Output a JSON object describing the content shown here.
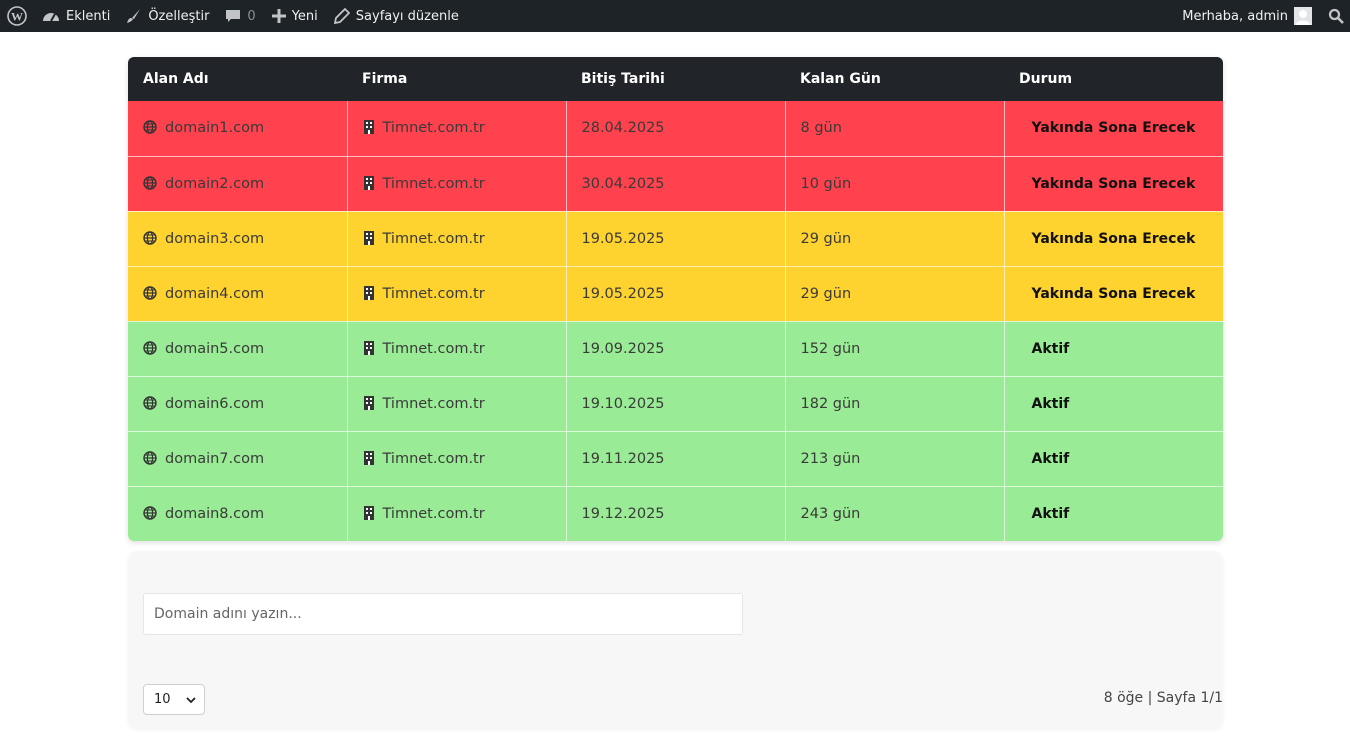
{
  "adminbar": {
    "plugins_label": "Eklenti",
    "customize_label": "Özelleştir",
    "comments_count": "0",
    "new_label": "Yeni",
    "edit_page_label": "Sayfayı düzenle",
    "greeting": "Merhaba, admin"
  },
  "table": {
    "headers": [
      "Alan Adı",
      "Firma",
      "Bitiş Tarihi",
      "Kalan Gün",
      "Durum"
    ],
    "rows": [
      {
        "domain": "domain1.com",
        "company": "Timnet.com.tr",
        "end_date": "28.04.2025",
        "days_left": "8 gün",
        "status": "Yakında Sona Erecek",
        "color": "#ff424e"
      },
      {
        "domain": "domain2.com",
        "company": "Timnet.com.tr",
        "end_date": "30.04.2025",
        "days_left": "10 gün",
        "status": "Yakında Sona Erecek",
        "color": "#ff424e"
      },
      {
        "domain": "domain3.com",
        "company": "Timnet.com.tr",
        "end_date": "19.05.2025",
        "days_left": "29 gün",
        "status": "Yakında Sona Erecek",
        "color": "#fed22f"
      },
      {
        "domain": "domain4.com",
        "company": "Timnet.com.tr",
        "end_date": "19.05.2025",
        "days_left": "29 gün",
        "status": "Yakında Sona Erecek",
        "color": "#fed22f"
      },
      {
        "domain": "domain5.com",
        "company": "Timnet.com.tr",
        "end_date": "19.09.2025",
        "days_left": "152 gün",
        "status": "Aktif",
        "color": "#99ec95"
      },
      {
        "domain": "domain6.com",
        "company": "Timnet.com.tr",
        "end_date": "19.10.2025",
        "days_left": "182 gün",
        "status": "Aktif",
        "color": "#99ec95"
      },
      {
        "domain": "domain7.com",
        "company": "Timnet.com.tr",
        "end_date": "19.11.2025",
        "days_left": "213 gün",
        "status": "Aktif",
        "color": "#99ec95"
      },
      {
        "domain": "domain8.com",
        "company": "Timnet.com.tr",
        "end_date": "19.12.2025",
        "days_left": "243 gün",
        "status": "Aktif",
        "color": "#99ec95"
      }
    ]
  },
  "search": {
    "placeholder": "Domain adını yazın..."
  },
  "pagination": {
    "per_page": "10",
    "info": "8 öğe | Sayfa 1/1"
  }
}
